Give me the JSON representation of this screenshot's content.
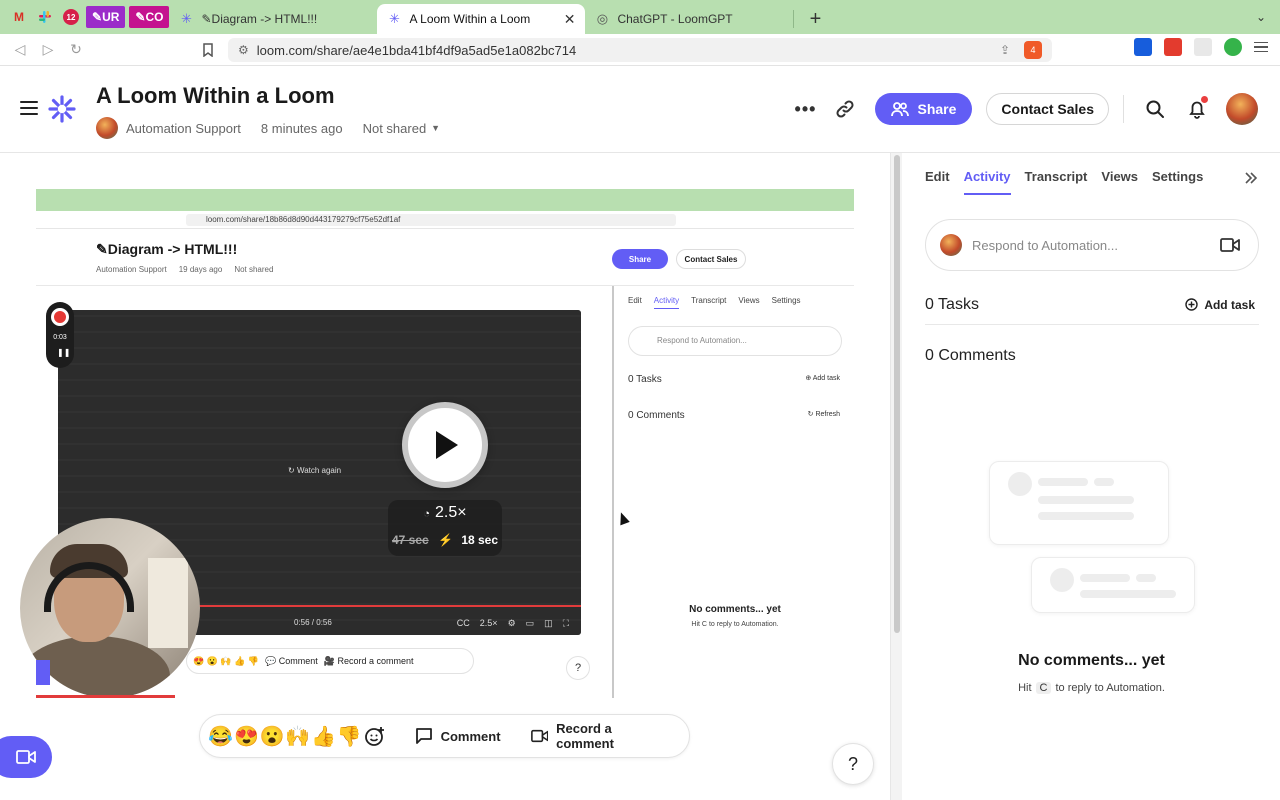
{
  "browser": {
    "pinned": [
      "M",
      "12",
      "UR",
      "CO"
    ],
    "tabs": [
      {
        "title": "✎Diagram -> HTML!!!",
        "active": false
      },
      {
        "title": "A Loom Within a Loom",
        "active": true
      },
      {
        "title": "ChatGPT - LoomGPT",
        "active": false
      }
    ],
    "url": "loom.com/share/ae4e1bda41bf4df9a5ad5e1a082bc714",
    "brave_badge": "4"
  },
  "header": {
    "title": "A Loom Within a Loom",
    "owner": "Automation Support",
    "time": "8 minutes ago",
    "visibility": "Not shared",
    "share_label": "Share",
    "contact_sales_label": "Contact Sales"
  },
  "video": {
    "nested": {
      "url": "loom.com/share/18b86d8d90d443179279cf75e52df1af",
      "title": "✎Diagram -> HTML!!!",
      "owner": "Automation Support",
      "time": "19 days ago",
      "visibility": "Not shared",
      "share_label": "Share",
      "contact_sales_label": "Contact Sales",
      "rec_time": "0:03",
      "watch_again": "Watch again",
      "timecode": "0:56 / 0:56",
      "rate": "2.5×",
      "tabs": [
        "Edit",
        "Activity",
        "Transcript",
        "Views",
        "Settings"
      ],
      "respond_placeholder": "Respond to Automation...",
      "tasks": "0 Tasks",
      "add_task": "Add task",
      "comments": "0 Comments",
      "refresh": "Refresh",
      "no_comments": "No comments... yet",
      "hit": "Hit",
      "key": "C",
      "hint": "to reply to Automation.",
      "comment_label": "Comment",
      "record_label": "Record a comment",
      "help": "?"
    },
    "speed_rate": "2.5×",
    "old_time": "47 sec",
    "new_time": "18 sec",
    "progress_fraction": 0.17
  },
  "reactions": {
    "emojis": [
      "😂",
      "😍",
      "😮",
      "🙌",
      "👍",
      "👎"
    ],
    "comment_label": "Comment",
    "record_label": "Record a comment"
  },
  "help_label": "?",
  "side": {
    "tabs": [
      "Edit",
      "Activity",
      "Transcript",
      "Views",
      "Settings"
    ],
    "active_tab": "Activity",
    "respond_placeholder": "Respond to Automation...",
    "tasks": "0 Tasks",
    "add_task": "Add task",
    "comments": "0 Comments",
    "no_comments": "No comments... yet",
    "hit": "Hit",
    "key": "C",
    "hint": "to reply to Automation."
  },
  "colors": {
    "accent": "#625df5",
    "tab_strip": "#b8dfb0",
    "progress": "#e23b3b"
  }
}
